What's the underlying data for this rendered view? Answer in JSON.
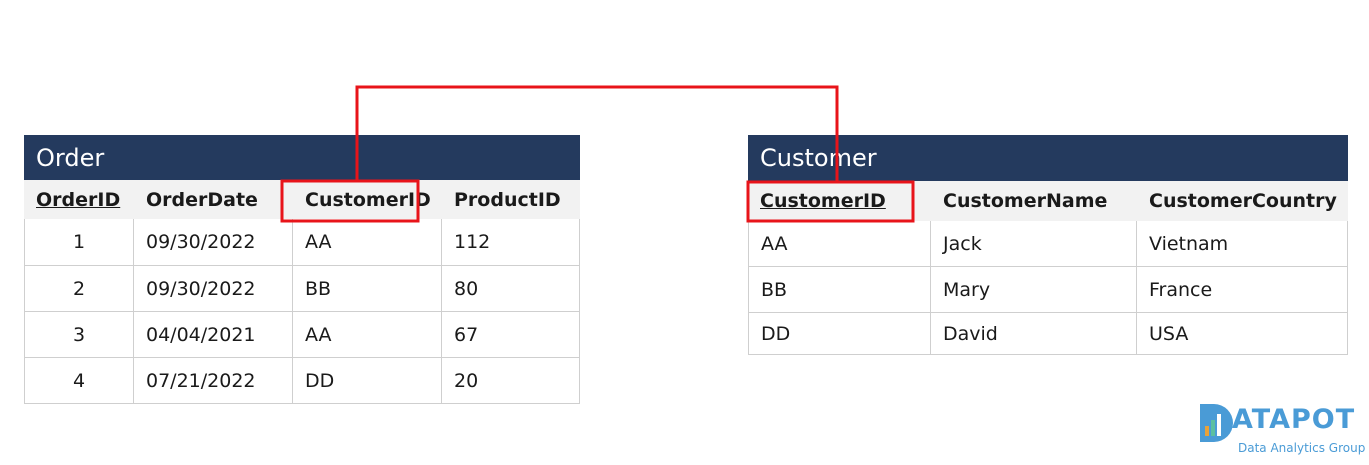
{
  "order": {
    "title": "Order",
    "headers": [
      "OrderID",
      "OrderDate",
      "CustomerID",
      "ProductID"
    ],
    "rows": [
      [
        "1",
        "09/30/2022",
        "AA",
        "112"
      ],
      [
        "2",
        "09/30/2022",
        "BB",
        "80"
      ],
      [
        "3",
        "04/04/2021",
        "AA",
        "67"
      ],
      [
        "4",
        "07/21/2022",
        "DD",
        "20"
      ]
    ]
  },
  "customer": {
    "title": "Customer",
    "headers": [
      "CustomerID",
      "CustomerName",
      "CustomerCountry"
    ],
    "rows": [
      [
        "AA",
        "Jack",
        "Vietnam"
      ],
      [
        "BB",
        "Mary",
        "France"
      ],
      [
        "DD",
        "David",
        "USA"
      ]
    ]
  },
  "logo": {
    "word": "ATAPOT",
    "subtitle": "Data Analytics Group"
  },
  "colors": {
    "header_bg": "#243a5e",
    "link": "#e8141a",
    "logo": "#4a9bd6"
  }
}
